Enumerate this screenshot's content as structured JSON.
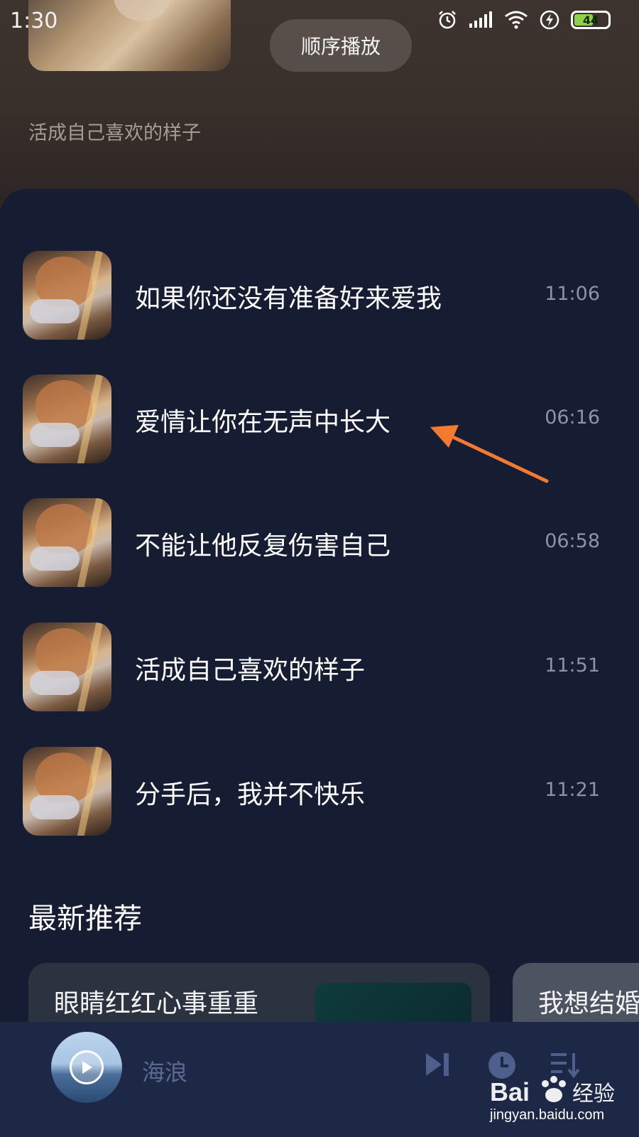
{
  "status_bar": {
    "time": "1:30",
    "battery": "44"
  },
  "header": {
    "play_order_label": "顺序播放",
    "subtitle": "活成自己喜欢的样子"
  },
  "songs": [
    {
      "title": "如果你还没有准备好来爱我",
      "duration": "11:06"
    },
    {
      "title": "爱情让你在无声中长大",
      "duration": "06:16"
    },
    {
      "title": "不能让他反复伤害自己",
      "duration": "06:58"
    },
    {
      "title": "活成自己喜欢的样子",
      "duration": "11:51"
    },
    {
      "title": "分手后，我并不快乐",
      "duration": "11:21"
    }
  ],
  "recommend": {
    "section_title": "最新推荐",
    "cards": [
      {
        "title": "眼睛红红心事重重"
      },
      {
        "title": "我想结婚"
      }
    ]
  },
  "player": {
    "now_playing": "海浪"
  },
  "watermark": {
    "site": "jingyan.baidu.com",
    "brand": "Bai 经验"
  },
  "colors": {
    "background": "#171e33",
    "annotation_arrow": "#f47a32",
    "player_bar": "#1d2746"
  }
}
